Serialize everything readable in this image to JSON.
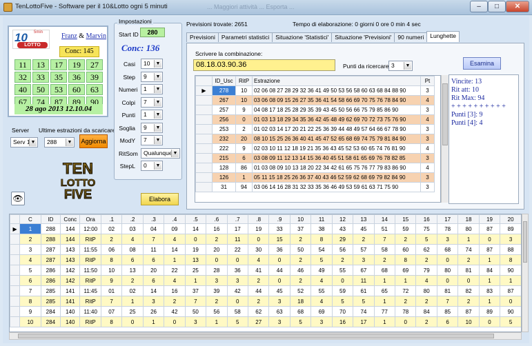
{
  "window": {
    "title": "TenLottoFive - Software per il 10&Lotto ogni 5 minuti",
    "menu_ghost": "... Maggiori attività  ... Esporta ..."
  },
  "logo_card": {
    "lotto_10": "10",
    "lotto_min": "5min",
    "lotto_word": "LOTTO",
    "author1": "Franz",
    "author_sep": "&",
    "author2": "Marvin",
    "conc_label": "Conc: 145",
    "numbers": [
      "11",
      "13",
      "17",
      "19",
      "27",
      "32",
      "33",
      "35",
      "36",
      "39",
      "40",
      "50",
      "53",
      "60",
      "63",
      "67",
      "74",
      "87",
      "89",
      "90"
    ],
    "date": "28 ago 2013 12.10.04"
  },
  "server": {
    "label": "Server",
    "value": "Serv 1",
    "estr_label": "Ultime estrazioni da scaricare",
    "estr_value": "288",
    "agg_button": "Aggiorna"
  },
  "settings": {
    "legend": "Impostazioni",
    "start_label": "Start ID",
    "start_value": "280",
    "conc_title": "Conc: 136",
    "fields": [
      {
        "label": "Casi",
        "value": "10"
      },
      {
        "label": "Step",
        "value": "9"
      },
      {
        "label": "Numeri",
        "value": "1"
      },
      {
        "label": "Colpi",
        "value": "7"
      },
      {
        "label": "Punti",
        "value": "1"
      },
      {
        "label": "Soglia",
        "value": "9"
      },
      {
        "label": "ModY",
        "value": "7"
      },
      {
        "label": "RitSom",
        "value": "Qualunque"
      },
      {
        "label": "StepL",
        "value": "0"
      }
    ],
    "elabora_button": "Elabora"
  },
  "status": {
    "previsioni": "Previsioni trovate: 2651",
    "tempo": "Tempo di elaborazione: 0 giorni 0 ore 0 min 4 sec"
  },
  "tabs": [
    "Previsioni",
    "Parametri statistici",
    "Situazione 'Statistici'",
    "Situazione 'Previsioni'",
    "90 numeri",
    "Lunghette"
  ],
  "active_tab": "Lunghette",
  "lunghette": {
    "scrivere_label": "Scrivere la combinazione:",
    "combination_value": "08.18.03.90.36",
    "punti_label": "Punti da ricercare:",
    "punti_value": "3",
    "esamina_button": "Esamina",
    "columns": [
      "ID_Usc",
      "RitP",
      "Estrazione",
      "Pt"
    ],
    "rows": [
      {
        "id": "278",
        "ritp": "10",
        "estr": "02 06 08 27 28 29 32 36 41 49 50 53 56 58 60 63 68 84 88 90",
        "pt": "3",
        "hl": "sel"
      },
      {
        "id": "267",
        "ritp": "10",
        "estr": "03 06 08 09 15 26 27 35 36 41 54 58 66 69 70 75 76 78 84 90",
        "pt": "4",
        "hl": "orange"
      },
      {
        "id": "257",
        "ritp": "9",
        "estr": "04 08 17 18 25 28 29 35 39 43 45 50 56 66 75 79 85 86 90",
        "pt": "3",
        "hl": ""
      },
      {
        "id": "256",
        "ritp": "0",
        "estr": "01 03 13 18 29 34 35 36 42 45 48 49 62 69 70 72 73 75 76 90",
        "pt": "4",
        "hl": "orange"
      },
      {
        "id": "253",
        "ritp": "2",
        "estr": "01 02 03 14 17 20 21 22 25 36 39 44 48 49 57 64 66 67 78 90",
        "pt": "3",
        "hl": ""
      },
      {
        "id": "232",
        "ritp": "20",
        "estr": "08 10 15 25 26 36 40 41 45 47 52 65 68 69 74 75 79 81 84 90",
        "pt": "3",
        "hl": "orange"
      },
      {
        "id": "222",
        "ritp": "9",
        "estr": "02 03 10 11 12 18 19 21 35 36 43 45 52 53 60 65 74 76 81 90",
        "pt": "4",
        "hl": ""
      },
      {
        "id": "215",
        "ritp": "6",
        "estr": "03 08 09 11 12 13 14 15 36 40 45 51 58 61 65 69 76 78 82 85",
        "pt": "3",
        "hl": "orange"
      },
      {
        "id": "128",
        "ritp": "86",
        "estr": "01 03 08 09 10 13 18 20 22 34 42 61 65 75 76 77 79 83 86 90",
        "pt": "4",
        "hl": ""
      },
      {
        "id": "126",
        "ritp": "1",
        "estr": "05 11 15 18 25 26 36 37 40 43 46 52 59 62 68 69 79 82 84 90",
        "pt": "3",
        "hl": "orange"
      },
      {
        "id": "31",
        "ritp": "94",
        "estr": "03 06 14 16 28 31 32 33 35 36 46 49 53 59 61 63 71 75 90",
        "pt": "3",
        "hl": ""
      }
    ],
    "stats": {
      "vincite": "Vincite: 13",
      "rit_att": "Rit att: 10",
      "rit_max": "Rit Max: 94",
      "stars": "+ + + + + + + + + +",
      "punti3": "Punti [3]: 9",
      "punti4": "Punti [4]: 4"
    }
  },
  "main_grid": {
    "columns": [
      "C",
      "ID",
      "Conc",
      "Ora",
      ".1",
      ".2",
      ".3",
      ".4",
      ".5",
      ".6",
      ".7",
      ".8",
      ".9",
      "10",
      "11",
      "12",
      "13",
      "14",
      "15",
      "16",
      "17",
      "18",
      "19",
      "20"
    ],
    "rows": [
      [
        "1",
        "288",
        "144",
        "12:00",
        "02",
        "03",
        "04",
        "09",
        "14",
        "16",
        "17",
        "19",
        "33",
        "37",
        "38",
        "43",
        "45",
        "51",
        "59",
        "75",
        "78",
        "80",
        "87",
        "89"
      ],
      [
        "2",
        "288",
        "144",
        "RitP",
        "2",
        "4",
        "7",
        "4",
        "0",
        "2",
        "11",
        "0",
        "15",
        "2",
        "8",
        "29",
        "2",
        "7",
        "2",
        "5",
        "3",
        "1",
        "0",
        "3"
      ],
      [
        "3",
        "287",
        "143",
        "11:55",
        "06",
        "08",
        "11",
        "14",
        "19",
        "20",
        "22",
        "30",
        "36",
        "50",
        "54",
        "56",
        "57",
        "58",
        "60",
        "62",
        "68",
        "74",
        "87",
        "88"
      ],
      [
        "4",
        "287",
        "143",
        "RitP",
        "8",
        "6",
        "6",
        "1",
        "13",
        "0",
        "0",
        "4",
        "0",
        "2",
        "5",
        "2",
        "3",
        "2",
        "8",
        "2",
        "0",
        "2",
        "1",
        "8"
      ],
      [
        "5",
        "286",
        "142",
        "11:50",
        "10",
        "13",
        "20",
        "22",
        "25",
        "28",
        "36",
        "41",
        "44",
        "46",
        "49",
        "55",
        "67",
        "68",
        "69",
        "79",
        "80",
        "81",
        "84",
        "90"
      ],
      [
        "6",
        "286",
        "142",
        "RitP",
        "9",
        "2",
        "6",
        "4",
        "1",
        "3",
        "3",
        "2",
        "0",
        "2",
        "4",
        "0",
        "11",
        "1",
        "1",
        "4",
        "0",
        "0",
        "1",
        "1"
      ],
      [
        "7",
        "285",
        "141",
        "11:45",
        "01",
        "02",
        "14",
        "16",
        "37",
        "39",
        "42",
        "44",
        "45",
        "52",
        "55",
        "59",
        "61",
        "65",
        "72",
        "80",
        "81",
        "82",
        "83",
        "87"
      ],
      [
        "8",
        "285",
        "141",
        "RitP",
        "7",
        "1",
        "3",
        "2",
        "7",
        "2",
        "0",
        "2",
        "3",
        "18",
        "4",
        "5",
        "5",
        "1",
        "2",
        "2",
        "7",
        "2",
        "1",
        "0"
      ],
      [
        "9",
        "284",
        "140",
        "11:40",
        "07",
        "25",
        "26",
        "42",
        "50",
        "56",
        "58",
        "62",
        "63",
        "68",
        "69",
        "70",
        "74",
        "77",
        "78",
        "84",
        "85",
        "87",
        "89",
        "90"
      ],
      [
        "10",
        "284",
        "140",
        "RitP",
        "8",
        "0",
        "1",
        "0",
        "3",
        "1",
        "5",
        "27",
        "3",
        "5",
        "3",
        "16",
        "17",
        "1",
        "0",
        "2",
        "6",
        "10",
        "0",
        "5"
      ]
    ]
  }
}
